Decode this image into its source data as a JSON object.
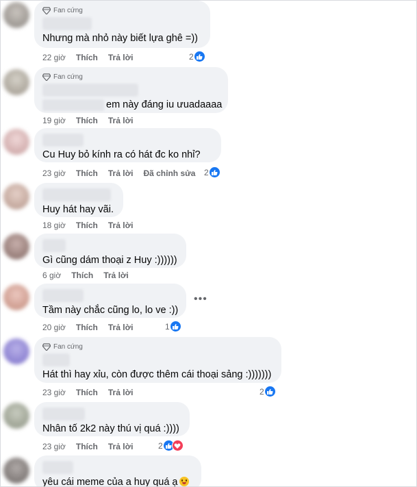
{
  "labels": {
    "like": "Thích",
    "reply": "Trả lời",
    "edited": "Đã chỉnh sửa",
    "fan_badge": "Fan cứng"
  },
  "comments": [
    {
      "badge": true,
      "text": "Nhưng mà nhỏ này biết lựa ghê =))",
      "time": "22 giờ",
      "reactions": "2"
    },
    {
      "badge": true,
      "text": "em này đáng iu ưuadaaaa",
      "time": "19 giờ"
    },
    {
      "text": "Cu Huy bỏ kính ra có hát đc ko nhỉ?",
      "time": "23 giờ",
      "edited": true,
      "reactions": "2"
    },
    {
      "text": "Huy hát hay vãi.",
      "time": "18 giờ"
    },
    {
      "text": "Gì cũng dám thoại z Huy :))))))",
      "time": "6 giờ"
    },
    {
      "text": "Tầm này chắc cũng lo, lo ve :))",
      "time": "20 giờ",
      "reactions": "1"
    },
    {
      "badge": true,
      "text": "Hát thì hay xỉu, còn được thêm cái thoại sảng :)))))))",
      "time": "23 giờ",
      "reactions": "2"
    },
    {
      "text": "Nhân tố 2k2 này thú vị quá :))))",
      "time": "23 giờ",
      "reactions": "2"
    },
    {
      "text": "yêu cái meme của a huy quá ạ"
    }
  ],
  "icons": {
    "like": "thumbs-up-icon",
    "love": "heart-icon",
    "badge": "diamond-icon",
    "more": "more-options-icon",
    "emoji": "grinning-face-emoji"
  },
  "colors": {
    "like_blue": "#1877f2",
    "love_red": "#f33e58",
    "bubble_bg": "#f0f2f5",
    "meta_gray": "#65676b"
  }
}
